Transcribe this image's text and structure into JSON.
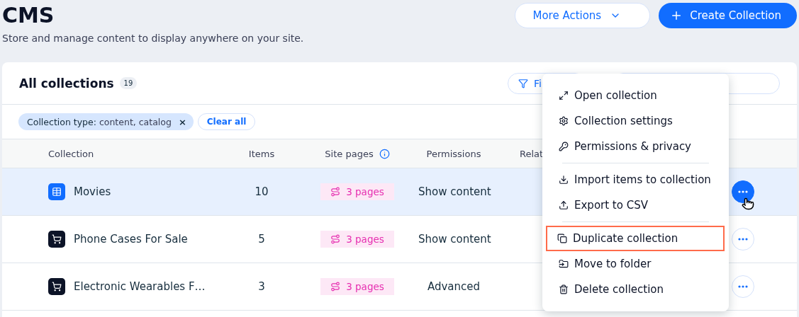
{
  "header": {
    "title": "CMS",
    "subtitle": "Store and manage content to display anywhere on your site.",
    "more_actions": "More Actions",
    "create": "Create Collection"
  },
  "card": {
    "title": "All collections",
    "count": "19",
    "filter_button": "Fi",
    "chip": {
      "label": "Collection type:",
      "value": "content, catalog",
      "close": "×"
    },
    "clear_all": "Clear all",
    "columns": [
      "Collection",
      "Items",
      "Site pages",
      "Permissions",
      "Relat"
    ],
    "rows": [
      {
        "kind": "content",
        "name": "Movies",
        "items": "10",
        "pages": "3 pages",
        "permissions": "Show content",
        "selected": true
      },
      {
        "kind": "catalog",
        "name": "Phone Cases For Sale",
        "items": "5",
        "pages": "3 pages",
        "permissions": "Show content",
        "selected": false
      },
      {
        "kind": "catalog",
        "name": "Electronic Wearables F…",
        "items": "3",
        "pages": "3 pages",
        "permissions": "Advanced",
        "selected": false
      }
    ]
  },
  "menu": {
    "groups": [
      [
        {
          "kind": "open",
          "label": "Open collection",
          "highlighted": false
        },
        {
          "kind": "settings",
          "label": "Collection settings",
          "highlighted": false
        },
        {
          "kind": "permissions",
          "label": "Permissions & privacy",
          "highlighted": false
        }
      ],
      [
        {
          "kind": "import",
          "label": "Import items to collection",
          "highlighted": false
        },
        {
          "kind": "export",
          "label": "Export to CSV",
          "highlighted": false
        }
      ],
      [
        {
          "kind": "duplicate",
          "label": "Duplicate collection",
          "highlighted": true
        },
        {
          "kind": "move",
          "label": "Move to folder",
          "highlighted": false
        },
        {
          "kind": "delete",
          "label": "Delete collection",
          "highlighted": false
        }
      ]
    ]
  }
}
